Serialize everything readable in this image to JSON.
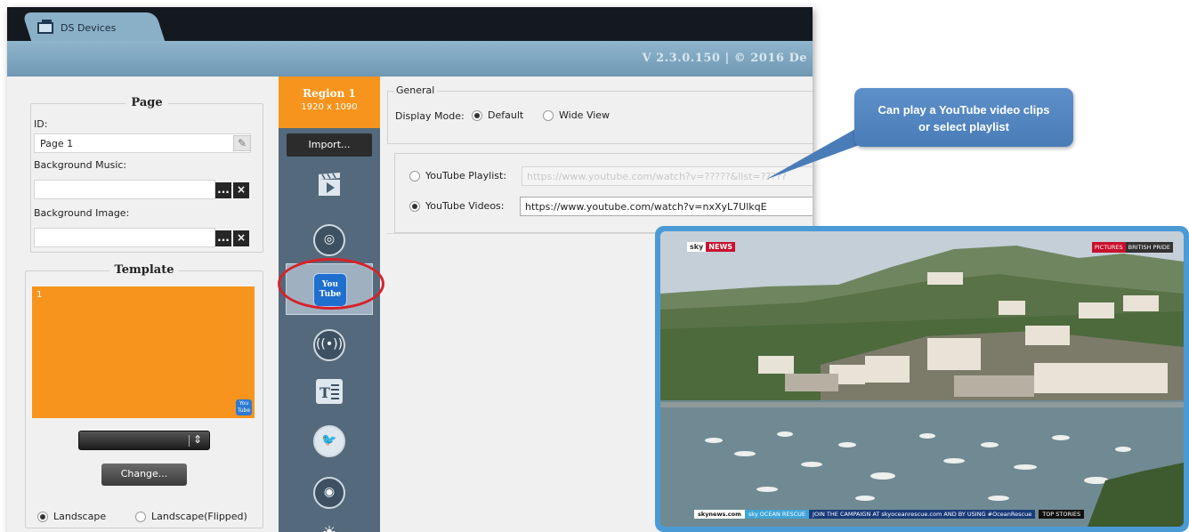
{
  "app": {
    "tab_label": "DS Devices",
    "version": "V 2.3.0.150  |  © 2016 De"
  },
  "page_panel": {
    "title": "Page",
    "id_label": "ID:",
    "id_value": "Page 1",
    "bg_music_label": "Background Music:",
    "bg_music_value": "",
    "bg_image_label": "Background Image:",
    "bg_image_value": "",
    "browse_label": "...",
    "clear_label": "×"
  },
  "template_panel": {
    "title": "Template",
    "region_number": "1",
    "yt_badge": "You Tube",
    "select_value": "",
    "change_label": "Change...",
    "orientation_options": [
      "Landscape",
      "Landscape(Flipped)"
    ]
  },
  "toolbar": {
    "region_title": "Region 1",
    "region_size": "1920 x 1090",
    "import_label": "Import...",
    "tools": [
      "video-tool",
      "web-tool",
      "youtube-tool",
      "stream-tool",
      "text-tool",
      "twitter-tool",
      "rss-tool",
      "weather-tool"
    ]
  },
  "general": {
    "legend": "General",
    "display_mode_label": "Display Mode:",
    "display_mode_options": [
      "Default",
      "Wide View"
    ],
    "display_mode_selected": "Default"
  },
  "youtube": {
    "playlist_label": "YouTube Playlist:",
    "playlist_value": "https://www.youtube.com/watch?v=?????&list=?????",
    "videos_label": "YouTube Videos:",
    "videos_value": "https://www.youtube.com/watch?v=nxXyL7UlkqE",
    "selected": "YouTube Videos"
  },
  "callout": {
    "text_line1": "Can play a YouTube video clips",
    "text_line2": "or select playlist"
  },
  "video_preview": {
    "channel_logo_a": "sky",
    "channel_logo_b": "NEWS",
    "banner_a": "PICTURES",
    "banner_b": "BRITISH PRIDE",
    "ticker_site": "skynews.com",
    "ticker_tag": "sky OCEAN RESCUE",
    "ticker_text": "JOIN THE CAMPAIGN AT skyoceanrescue.com AND BY USING #OceanRescue",
    "ticker_top": "TOP STORIES"
  },
  "colors": {
    "accent_orange": "#f7941d",
    "sidebar_slate": "#546a7c",
    "youtube_blue": "#1f6fce",
    "highlight_red": "#d8212a",
    "callout_blue": "#5d8fc9"
  }
}
